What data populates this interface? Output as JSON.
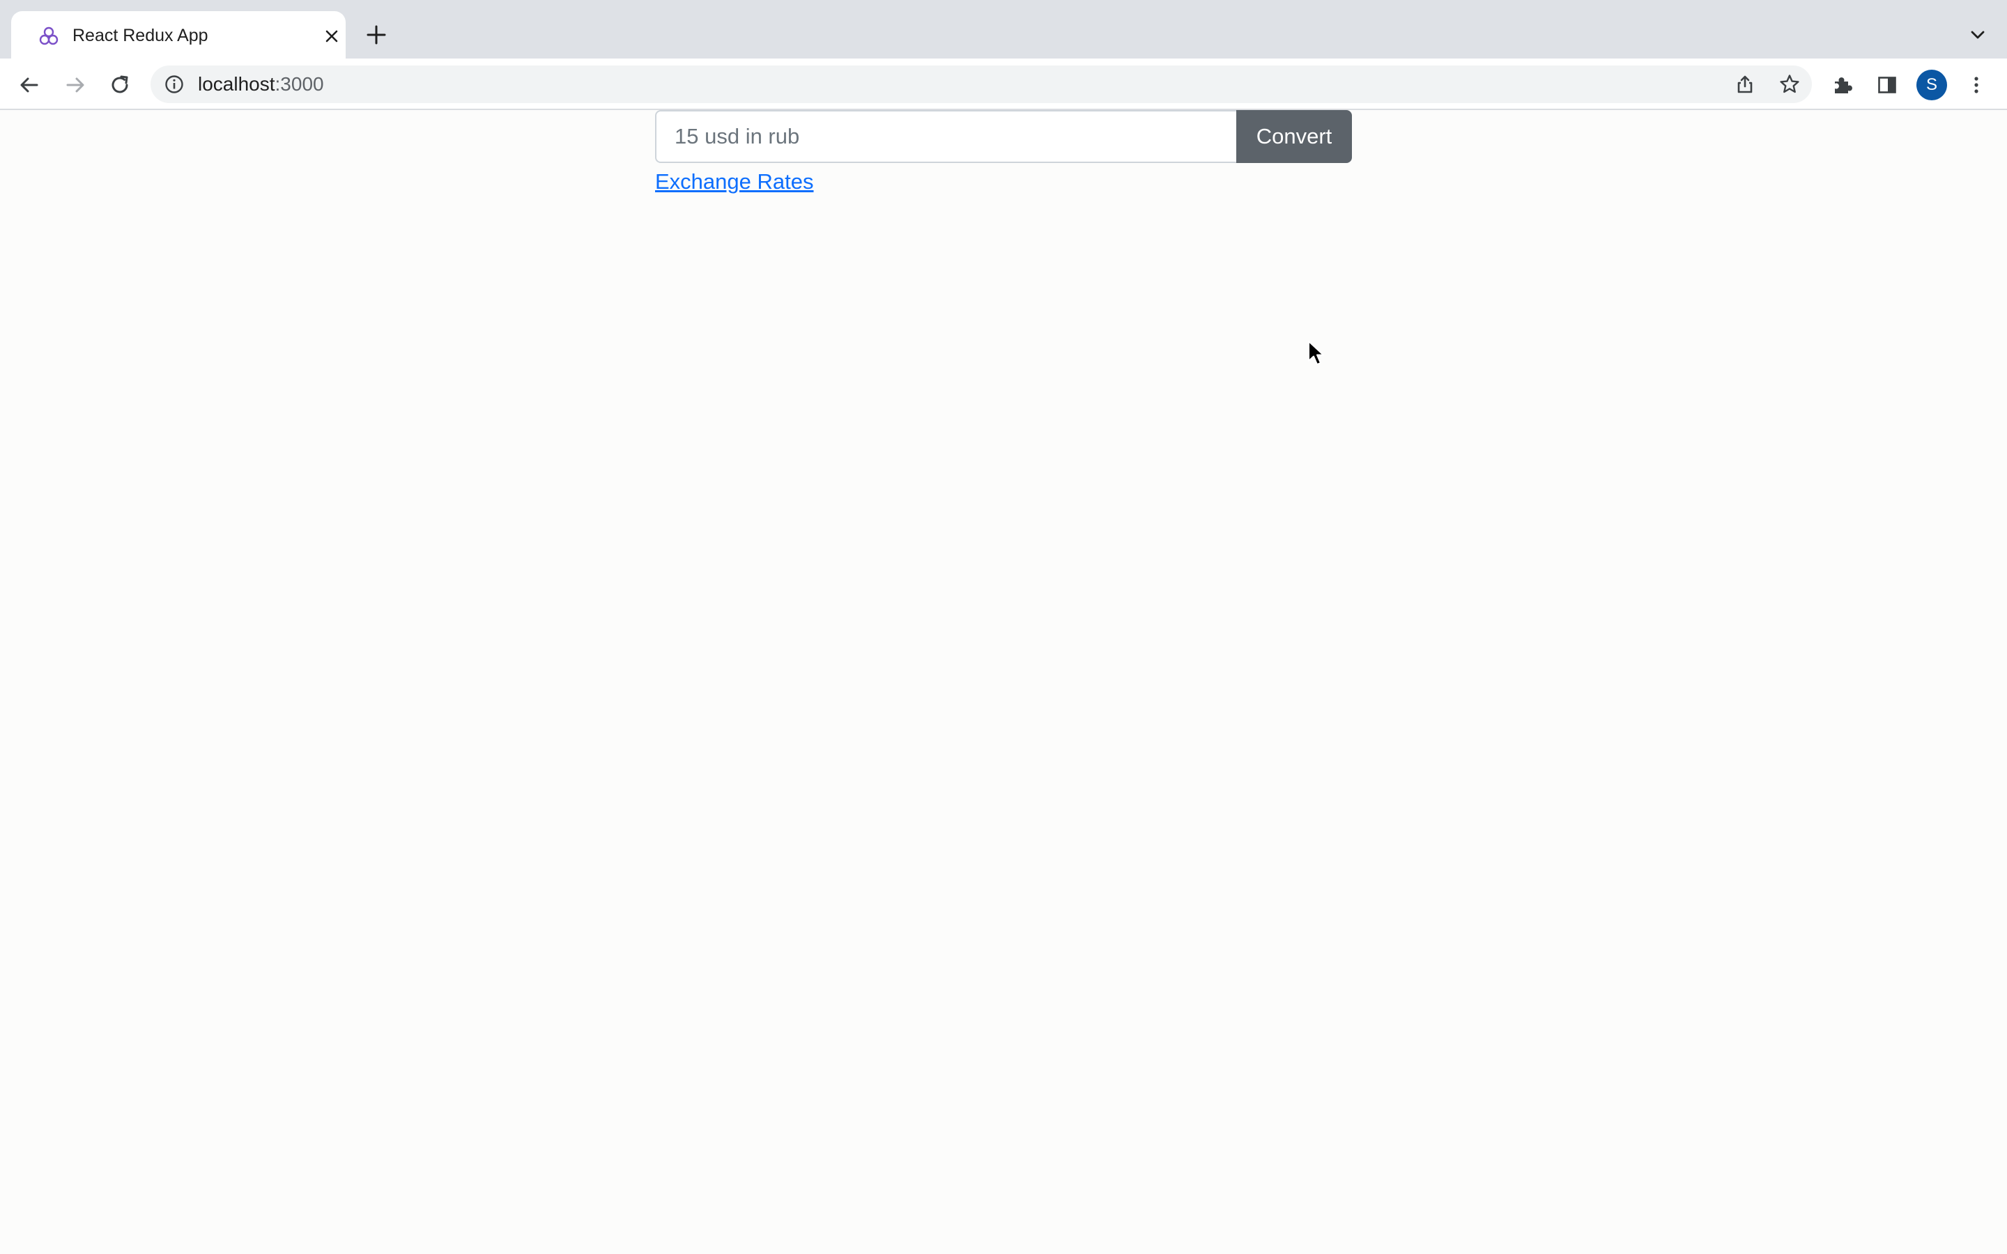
{
  "browser": {
    "tab": {
      "title": "React Redux App",
      "favicon": "react-redux-icon",
      "close_icon": "close-icon"
    },
    "new_tab_icon": "plus-icon",
    "tab_search_icon": "chevron-down-icon",
    "toolbar": {
      "back_icon": "arrow-left-icon",
      "forward_icon": "arrow-right-icon",
      "reload_icon": "reload-icon",
      "site_info_icon": "info-icon",
      "url_host": "localhost",
      "url_port": ":3000",
      "share_icon": "share-icon",
      "bookmark_icon": "star-icon",
      "extensions_icon": "puzzle-icon",
      "side_panel_icon": "side-panel-icon",
      "profile_initial": "S",
      "menu_icon": "more-vert-icon"
    }
  },
  "page": {
    "converter": {
      "placeholder": "15 usd in rub",
      "button_label": "Convert"
    },
    "rates_link": "Exchange Rates"
  },
  "colors": {
    "accent_button": "#5c636a",
    "link": "#0d6efd",
    "avatar": "#0b57a4",
    "tab_strip": "#dee1e6"
  }
}
